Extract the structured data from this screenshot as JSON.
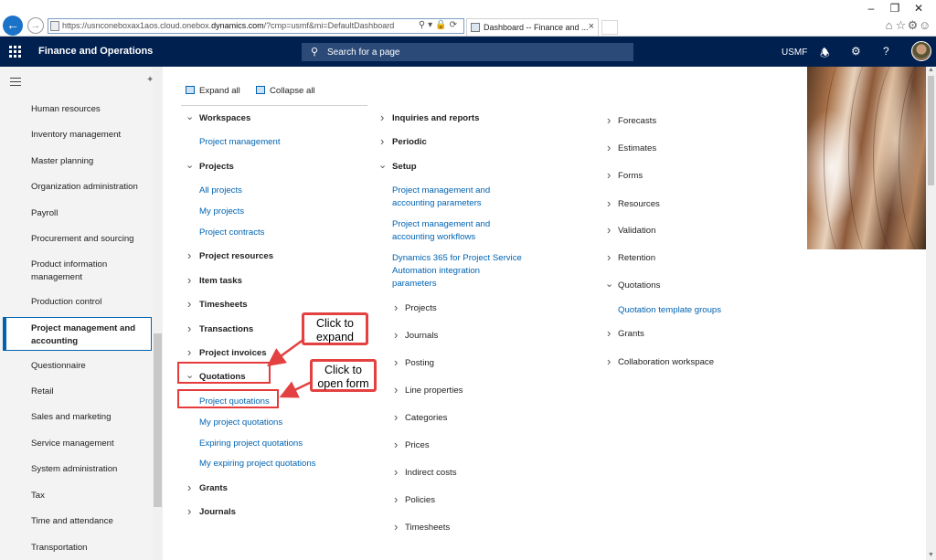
{
  "browser": {
    "url_prefix": "https://usnconeboxax1aos.cloud.onebox.",
    "url_domain": "dynamics.com",
    "url_suffix": "/?cmp=usmf&mi=DefaultDashboard",
    "tab_title": "Dashboard -- Finance and ..."
  },
  "header": {
    "app_title": "Finance and Operations",
    "search_placeholder": "Search for a page",
    "company": "USMF"
  },
  "sidebar": {
    "items": [
      "Human resources",
      "Inventory management",
      "Master planning",
      "Organization administration",
      "Payroll",
      "Procurement and sourcing",
      "Product information management",
      "Production control",
      "Project management and accounting",
      "Questionnaire",
      "Retail",
      "Sales and marketing",
      "Service management",
      "System administration",
      "Tax",
      "Time and attendance",
      "Transportation"
    ],
    "active_index": 8
  },
  "toolbar": {
    "expand_all": "Expand all",
    "collapse_all": "Collapse all"
  },
  "col1": {
    "workspaces": "Workspaces",
    "project_management": "Project management",
    "projects": "Projects",
    "all_projects": "All projects",
    "my_projects": "My projects",
    "project_contracts": "Project contracts",
    "project_resources": "Project resources",
    "item_tasks": "Item tasks",
    "timesheets": "Timesheets",
    "transactions": "Transactions",
    "project_invoices": "Project invoices",
    "quotations": "Quotations",
    "project_quotations": "Project quotations",
    "my_project_quotations": "My project quotations",
    "expiring_project_quotations": "Expiring project quotations",
    "my_expiring_project_quotations": "My expiring project quotations",
    "grants": "Grants",
    "journals": "Journals"
  },
  "col2": {
    "inquiries": "Inquiries and reports",
    "periodic": "Periodic",
    "setup": "Setup",
    "link1_l1": "Project management and",
    "link1_l2": "accounting parameters",
    "link2_l1": "Project management and",
    "link2_l2": "accounting workflows",
    "link3_l1": "Dynamics 365 for Project Service",
    "link3_l2": "Automation integration",
    "link3_l3": "parameters",
    "projects": "Projects",
    "journals": "Journals",
    "posting": "Posting",
    "line_properties": "Line properties",
    "categories": "Categories",
    "prices": "Prices",
    "indirect_costs": "Indirect costs",
    "policies": "Policies",
    "timesheets": "Timesheets"
  },
  "col3": {
    "forecasts": "Forecasts",
    "estimates": "Estimates",
    "forms": "Forms",
    "resources": "Resources",
    "validation": "Validation",
    "retention": "Retention",
    "quotations": "Quotations",
    "quotation_template_groups": "Quotation template groups",
    "grants": "Grants",
    "collaboration_workspace": "Collaboration workspace"
  },
  "callouts": {
    "expand_l1": "Click to",
    "expand_l2": "expand",
    "open_l1": "Click to",
    "open_l2": "open form"
  },
  "colors": {
    "header_bg": "#002050",
    "link": "#0063b1",
    "callout_border": "#e34141"
  }
}
